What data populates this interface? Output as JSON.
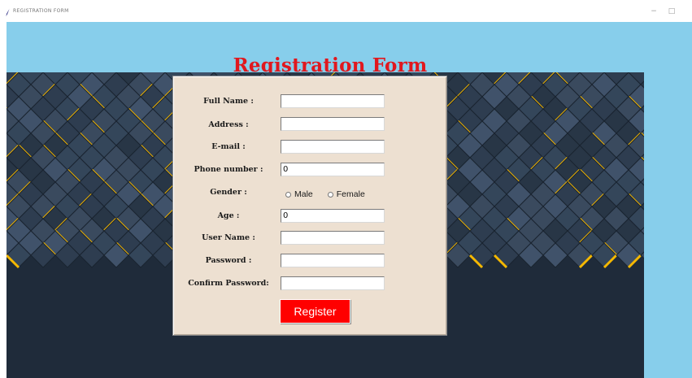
{
  "window": {
    "title": "REGISTRATION FORM",
    "minimize_glyph": "−",
    "maximize_glyph": "□"
  },
  "header": {
    "title": "Registration Form",
    "title_color": "#e0181e",
    "background_color": "#87ceeb"
  },
  "form": {
    "panel_color": "#ede0d1",
    "fields": {
      "full_name": {
        "label": "Full Name :",
        "value": ""
      },
      "address": {
        "label": "Address :",
        "value": ""
      },
      "email": {
        "label": "E-mail :",
        "value": ""
      },
      "phone": {
        "label": "Phone number :",
        "value": "0"
      },
      "gender": {
        "label": "Gender :",
        "options": [
          "Male",
          "Female"
        ],
        "selected": ""
      },
      "age": {
        "label": "Age :",
        "value": "0"
      },
      "username": {
        "label": "User Name :",
        "value": ""
      },
      "password": {
        "label": "Password :",
        "value": ""
      },
      "confirm_password": {
        "label": "Confirm Password:",
        "value": ""
      }
    },
    "register_button": {
      "label": "Register",
      "color": "#ff0000"
    }
  },
  "background": {
    "pattern": "dark-blue-cubes-with-yellow-edges",
    "base_color": "#1f2b3a",
    "accent_color": "#f5b800"
  }
}
